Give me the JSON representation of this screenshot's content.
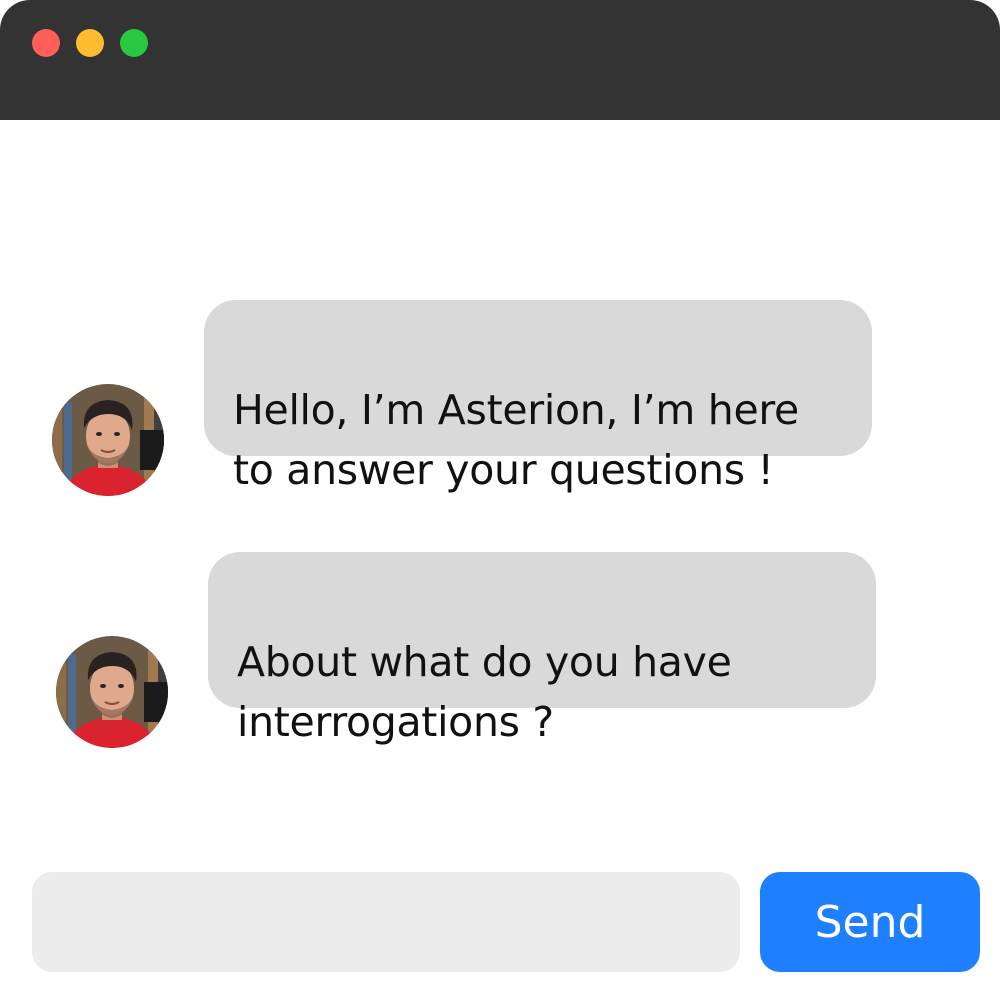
{
  "window": {
    "titlebar_color": "#333333",
    "traffic_lights": {
      "close_color": "#ff5f57",
      "minimize_color": "#febc2e",
      "maximize_color": "#28c840"
    }
  },
  "messages": [
    {
      "sender_avatar": "user-avatar-photo",
      "text": "Hello, I’m Asterion, I’m here\nto answer your questions !"
    },
    {
      "sender_avatar": "user-avatar-photo",
      "text": "About what do you have\ninterrogations ?"
    }
  ],
  "composer": {
    "input_value": "",
    "input_placeholder": "",
    "send_label": "Send",
    "send_color": "#1f80ff"
  }
}
